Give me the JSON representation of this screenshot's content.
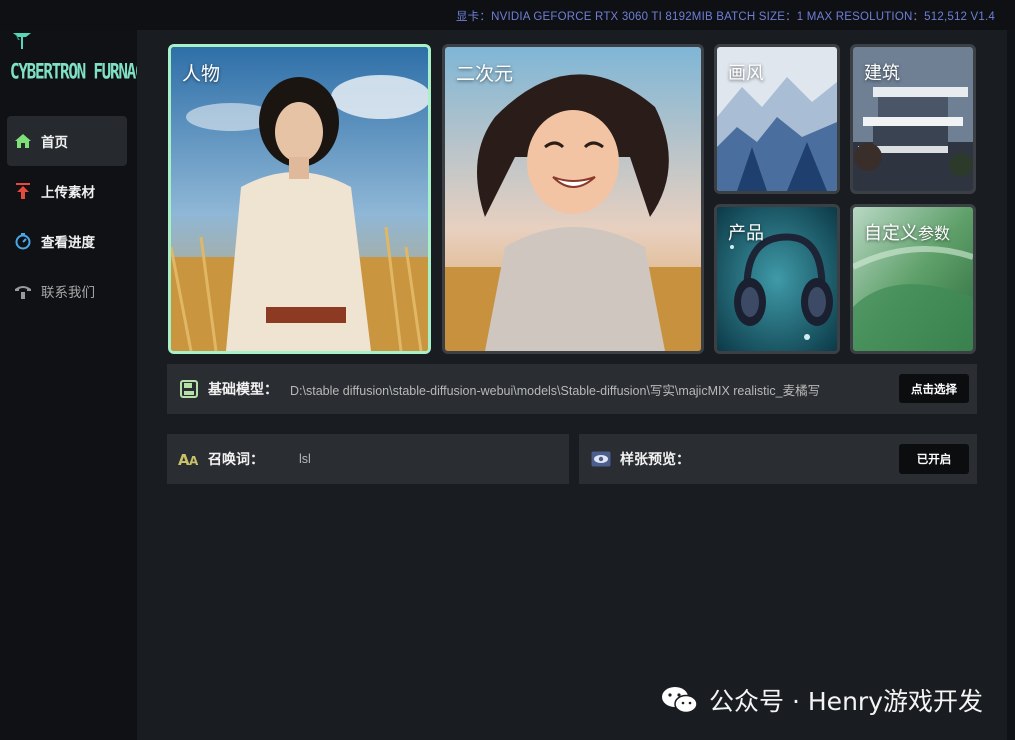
{
  "status_bar": {
    "text": "显卡：NVIDIA GEFORCE RTX 3060 TI 8192MIB  BATCH SIZE：1  MAX RESOLUTION：512,512 V1.4"
  },
  "logo": {
    "text": "CYBERTRON FURNACE",
    "icon": "trident-logo-icon"
  },
  "nav": [
    {
      "label": "首页",
      "icon": "home-icon",
      "active": true
    },
    {
      "label": "上传素材",
      "icon": "upload-arrow-icon",
      "active": false
    },
    {
      "label": "查看进度",
      "icon": "stopwatch-icon",
      "active": false
    },
    {
      "label": "联系我们",
      "icon": "phone-icon",
      "active": false
    }
  ],
  "categories": [
    {
      "label": "人物",
      "image": "portrait-woman-in-wheat-field",
      "selected": true
    },
    {
      "label": "二次元",
      "image": "anime-girl-smiling-in-field",
      "selected": false
    },
    {
      "label": "画风",
      "image": "ink-wash-mountain-landscape",
      "selected": false
    },
    {
      "label": "建筑",
      "image": "modern-cantilever-house",
      "selected": false
    },
    {
      "label": "产品",
      "image": "headphones-underwater",
      "selected": false
    },
    {
      "label_main": "自定义",
      "label_sub": "参数",
      "image": "green-abstract-waves",
      "selected": false
    }
  ],
  "base_model": {
    "label": "基础模型：",
    "value": "D:\\stable diffusion\\stable-diffusion-webui\\models\\Stable-diffusion\\写实\\majicMIX realistic_麦橘写",
    "button": "点击选择",
    "icon": "save-disk-icon"
  },
  "prompt": {
    "label": "召唤词：",
    "value": "lsl",
    "icon": "font-aa-icon"
  },
  "preview": {
    "label": "样张预览：",
    "button": "已开启",
    "icon": "eye-icon"
  },
  "watermark": {
    "text": "公众号 · Henry游戏开发",
    "icon": "wechat-icon"
  },
  "colors": {
    "accent_green": "#a8f0c8",
    "status_blue": "#6f7fd6",
    "panel_bg": "#2a2d31",
    "main_bg": "#191c20"
  }
}
